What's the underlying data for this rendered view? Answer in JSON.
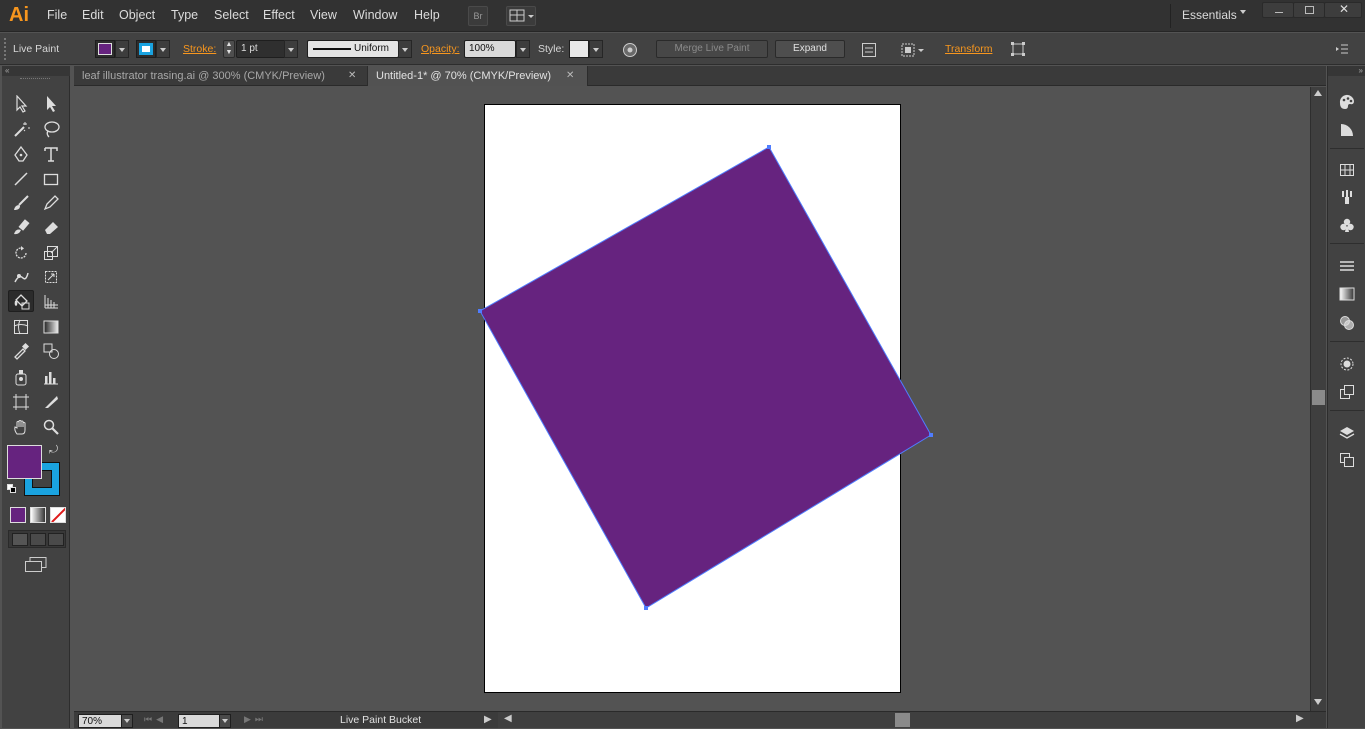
{
  "app": {
    "logo_text": "Ai"
  },
  "menu": {
    "items": [
      "File",
      "Edit",
      "Object",
      "Type",
      "Select",
      "Effect",
      "View",
      "Window",
      "Help"
    ]
  },
  "workspace": {
    "label": "Essentials"
  },
  "bridge_button": {
    "label": "Br"
  },
  "control_bar": {
    "tool_name": "Live Paint",
    "stroke_label": "Stroke:",
    "stroke_value": "1 pt",
    "profile_value": "Uniform",
    "opacity_label": "Opacity:",
    "opacity_value": "100%",
    "style_label": "Style:",
    "merge_label": "Merge Live Paint",
    "expand_label": "Expand",
    "transform_label": "Transform"
  },
  "tabs": [
    {
      "label": "leaf illustrator trasing.ai @ 300% (CMYK/Preview)",
      "close": "✕",
      "active": false
    },
    {
      "label": "Untitled-1* @ 70% (CMYK/Preview)",
      "close": "✕",
      "active": true
    }
  ],
  "status_bar": {
    "zoom": "70%",
    "page": "1",
    "tool_label": "Live Paint Bucket"
  },
  "colors": {
    "fill": "#66237f",
    "stroke": "#1aa3e0",
    "selection": "#4f7dff",
    "accent": "#f7961e"
  },
  "icons": [
    "selection-icon",
    "direct-selection-icon",
    "magic-wand-icon",
    "lasso-icon",
    "pen-icon",
    "type-icon",
    "line-segment-icon",
    "rectangle-icon",
    "paintbrush-icon",
    "pencil-icon",
    "blob-brush-icon",
    "eraser-icon",
    "rotate-icon",
    "scale-icon",
    "warp-icon",
    "free-transform-icon",
    "live-paint-bucket-icon",
    "perspective-grid-icon",
    "mesh-icon",
    "gradient-icon",
    "eyedropper-icon",
    "blend-icon",
    "symbol-sprayer-icon",
    "column-graph-icon",
    "artboard-icon",
    "slice-icon",
    "hand-icon",
    "zoom-icon"
  ]
}
